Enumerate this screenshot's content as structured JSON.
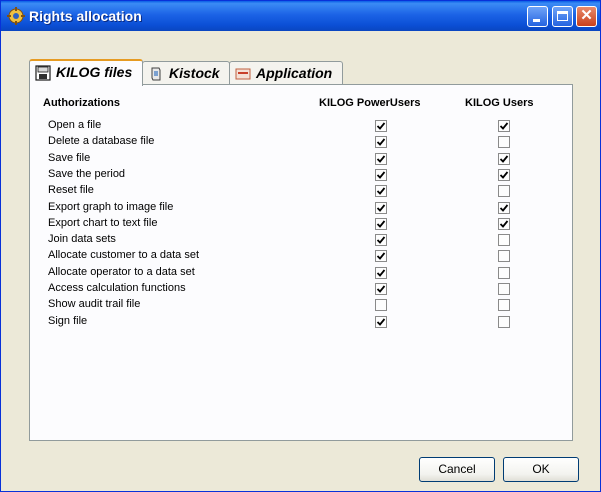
{
  "window": {
    "title": "Rights allocation"
  },
  "tabs": [
    {
      "label": "KILOG files",
      "icon": "kilog-files-icon",
      "active": true
    },
    {
      "label": "Kistock",
      "icon": "kistock-icon",
      "active": false
    },
    {
      "label": "Application",
      "icon": "kilog-app-icon",
      "active": false
    }
  ],
  "table": {
    "headers": {
      "authorizations": "Authorizations",
      "power_users": "KILOG PowerUsers",
      "users": "KILOG Users"
    },
    "rows": [
      {
        "label": "Open a file",
        "power_users": true,
        "users": true
      },
      {
        "label": "Delete a database file",
        "power_users": true,
        "users": false
      },
      {
        "label": "Save file",
        "power_users": true,
        "users": true
      },
      {
        "label": "Save the period",
        "power_users": true,
        "users": true
      },
      {
        "label": "Reset file",
        "power_users": true,
        "users": false
      },
      {
        "label": "Export graph to image file",
        "power_users": true,
        "users": true
      },
      {
        "label": "Export chart to text file",
        "power_users": true,
        "users": true
      },
      {
        "label": "Join data sets",
        "power_users": true,
        "users": false
      },
      {
        "label": "Allocate customer to a data set",
        "power_users": true,
        "users": false
      },
      {
        "label": "Allocate operator to a data set",
        "power_users": true,
        "users": false
      },
      {
        "label": "Access calculation functions",
        "power_users": true,
        "users": false
      },
      {
        "label": "Show audit trail file",
        "power_users": false,
        "users": false
      },
      {
        "label": "Sign file",
        "power_users": true,
        "users": false
      }
    ]
  },
  "buttons": {
    "cancel": "Cancel",
    "ok": "OK"
  },
  "colors": {
    "titlebar": "#0a5fe6",
    "dialog_face": "#ece9d8",
    "active_tab_accent": "#e69b22"
  }
}
